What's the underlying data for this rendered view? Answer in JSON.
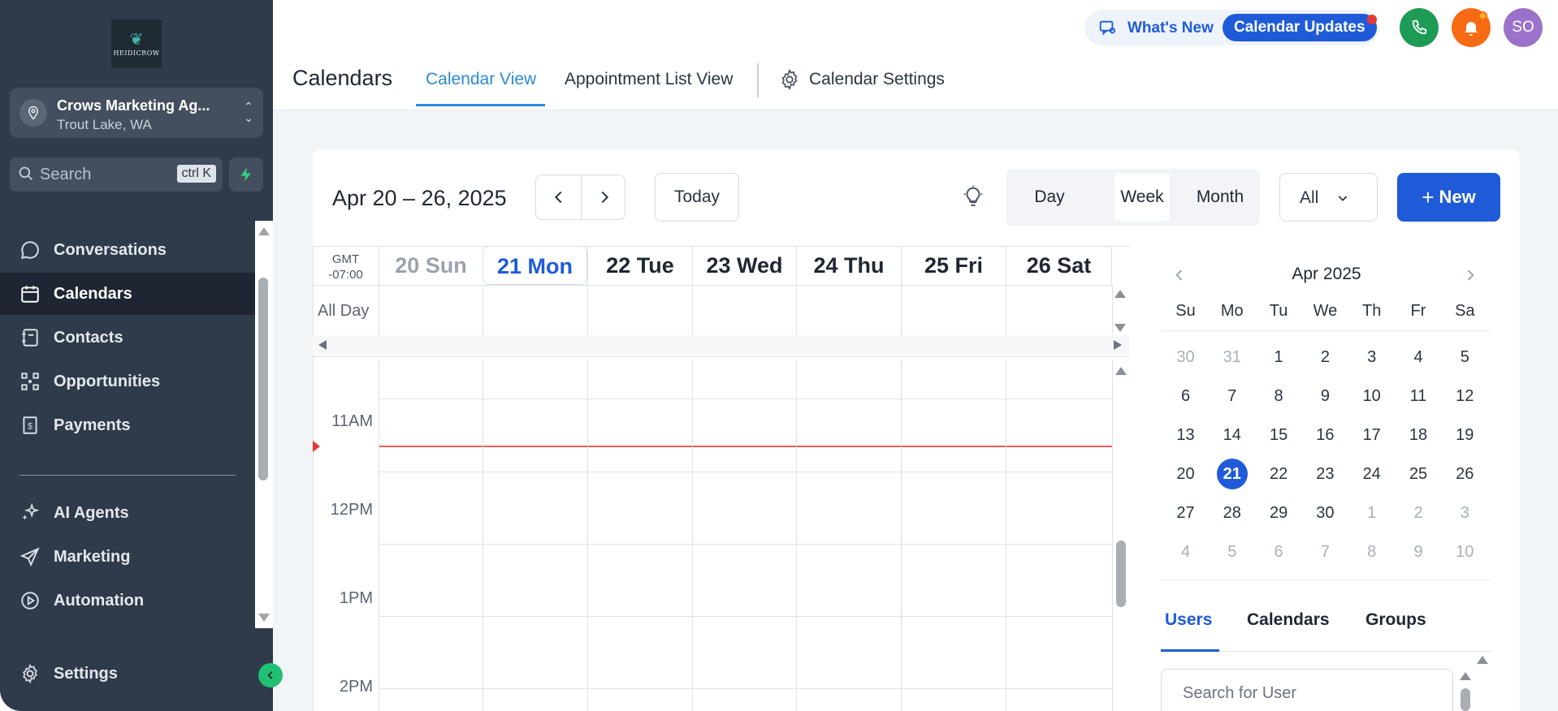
{
  "sidebar": {
    "logo_text": "HEIDICROW",
    "account": {
      "name": "Crows Marketing Ag...",
      "location": "Trout Lake, WA"
    },
    "search": {
      "placeholder": "Search",
      "shortcut": "ctrl K"
    },
    "nav_items": [
      {
        "label": "Conversations",
        "icon": "chat-bubble-icon"
      },
      {
        "label": "Calendars",
        "icon": "calendar-icon",
        "active": true
      },
      {
        "label": "Contacts",
        "icon": "contacts-book-icon"
      },
      {
        "label": "Opportunities",
        "icon": "pipeline-icon"
      },
      {
        "label": "Payments",
        "icon": "invoice-icon"
      },
      {
        "label": "AI Agents",
        "icon": "sparkles-icon"
      },
      {
        "label": "Marketing",
        "icon": "paper-plane-icon"
      },
      {
        "label": "Automation",
        "icon": "play-circle-icon"
      }
    ],
    "settings_label": "Settings"
  },
  "header": {
    "whats_new": "What's New",
    "calendar_updates": "Calendar Updates",
    "avatar_initials": "SO",
    "page_title": "Calendars",
    "tabs": [
      {
        "label": "Calendar View",
        "active": true
      },
      {
        "label": "Appointment List View"
      },
      {
        "label": "Calendar Settings"
      }
    ]
  },
  "toolbar": {
    "date_range": "Apr 20 – 26, 2025",
    "today_label": "Today",
    "views": [
      "Day",
      "Week",
      "Month"
    ],
    "active_view": "Week",
    "filter_value": "All",
    "new_label": "New"
  },
  "week": {
    "timezone_line1": "GMT",
    "timezone_line2": "-07:00",
    "all_day_label": "All Day",
    "days": [
      "20 Sun",
      "21 Mon",
      "22 Tue",
      "23 Wed",
      "24 Thu",
      "25 Fri",
      "26 Sat"
    ],
    "times": [
      "11AM",
      "12PM",
      "1PM",
      "2PM"
    ]
  },
  "mini_calendar": {
    "month": "Apr 2025",
    "weekdays": [
      "Su",
      "Mo",
      "Tu",
      "We",
      "Th",
      "Fr",
      "Sa"
    ],
    "weeks": [
      [
        "30",
        "31",
        "1",
        "2",
        "3",
        "4",
        "5"
      ],
      [
        "6",
        "7",
        "8",
        "9",
        "10",
        "11",
        "12"
      ],
      [
        "13",
        "14",
        "15",
        "16",
        "17",
        "18",
        "19"
      ],
      [
        "20",
        "21",
        "22",
        "23",
        "24",
        "25",
        "26"
      ],
      [
        "27",
        "28",
        "29",
        "30",
        "1",
        "2",
        "3"
      ],
      [
        "4",
        "5",
        "6",
        "7",
        "8",
        "9",
        "10"
      ]
    ],
    "selected": "21"
  },
  "right_panel": {
    "tabs": [
      "Users",
      "Calendars",
      "Groups"
    ],
    "search_placeholder": "Search for User"
  },
  "colors": {
    "sidebar_bg": "#2f3a4a",
    "accent_blue": "#1f5bd8",
    "tab_blue": "#2b8ad6",
    "now_line": "#ef5a5a",
    "phone_green": "#1d9b55",
    "bell_orange": "#f76b15",
    "avatar_purple": "#9b72c9"
  }
}
